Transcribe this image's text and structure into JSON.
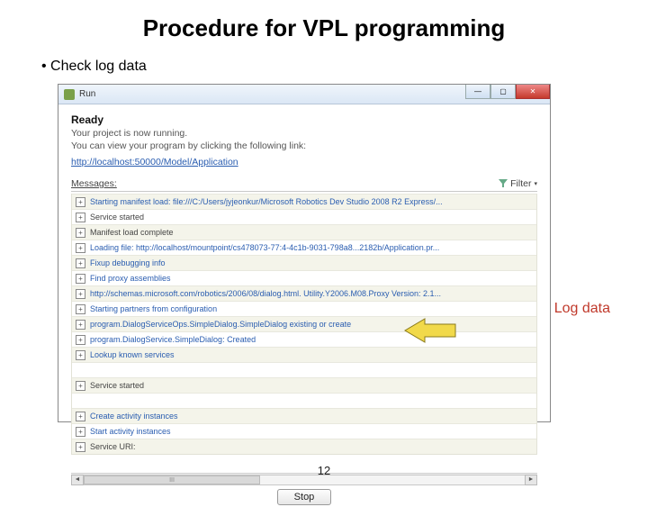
{
  "slide": {
    "title": "Procedure for VPL programming",
    "bullet": "Check log data",
    "page_number": "12"
  },
  "annotation": {
    "label": "Log data"
  },
  "window": {
    "title": "Run",
    "min": "—",
    "max": "▢",
    "close": "✕",
    "ready_heading": "Ready",
    "ready_sub": "Your project is now running.",
    "ready_sub2": "You can view your program by clicking the following link:",
    "ready_link": "http://localhost:50000/Model/Application",
    "messages_label": "Messages:",
    "filter_label": "Filter",
    "stop_label": "Stop",
    "scroll_thumb_label": "III",
    "log_rows": [
      {
        "icon": "+",
        "color": "blue",
        "text": "Starting manifest load: file:///C:/Users/jyjeonkur/Microsoft Robotics Dev Studio 2008 R2 Express/..."
      },
      {
        "icon": "+",
        "color": "",
        "text": "Service started"
      },
      {
        "icon": "+",
        "color": "",
        "text": "Manifest load complete"
      },
      {
        "icon": "+",
        "color": "blue",
        "text": "Loading file: http://localhost/mountpoint/cs478073-77:4-4c1b-9031-798a8...2182b/Application.pr..."
      },
      {
        "icon": "+",
        "color": "blue",
        "text": "Fixup debugging info"
      },
      {
        "icon": "+",
        "color": "blue",
        "text": "Find proxy assemblies"
      },
      {
        "icon": "+",
        "color": "blue",
        "text": "http://schemas.microsoft.com/robotics/2006/08/dialog.html. Utility.Y2006.M08.Proxy  Version: 2.1..."
      },
      {
        "icon": "+",
        "color": "blue",
        "text": "Starting partners from configuration"
      },
      {
        "icon": "+",
        "color": "blue",
        "text": "program.DialogServiceOps.SimpleDialog.SimpleDialog existing or create"
      },
      {
        "icon": "+",
        "color": "blue",
        "text": "program.DialogService.SimpleDialog: Created"
      },
      {
        "icon": "+",
        "color": "blue",
        "text": "Lookup known services"
      },
      {
        "icon": "+",
        "color": "",
        "text": "Service started"
      },
      {
        "icon": "+",
        "color": "blue",
        "text": "Create activity instances"
      },
      {
        "icon": "+",
        "color": "blue",
        "text": "Start activity instances"
      },
      {
        "icon": "+",
        "color": "",
        "text": "Service URI:"
      }
    ]
  }
}
